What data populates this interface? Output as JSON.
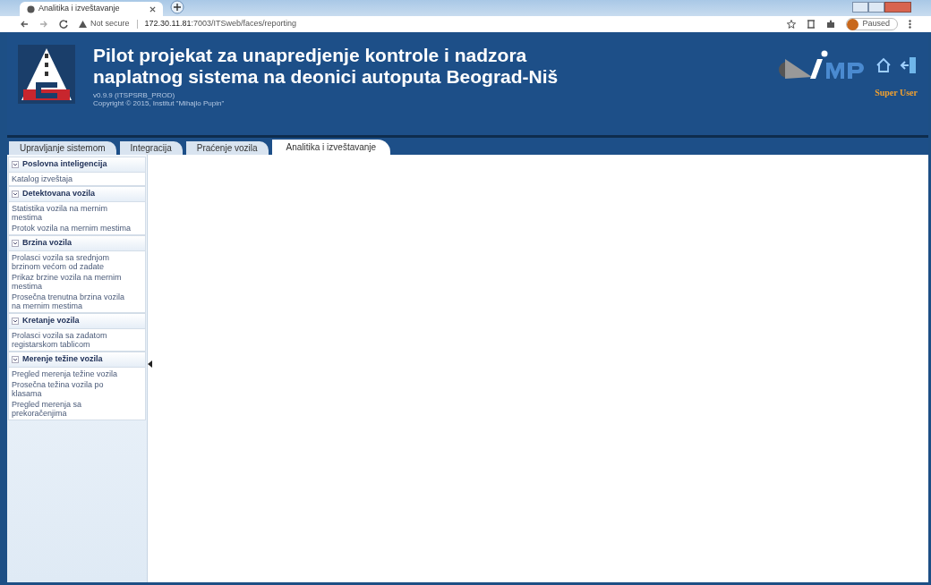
{
  "browser": {
    "tab_title": "Analitika i izveštavanje",
    "url_host": "172.30.11.81",
    "url_path": ":7003/ITSweb/faces/reporting",
    "security": "Not secure",
    "profile": "Paused"
  },
  "header": {
    "title_lines": [
      "Pilot projekat za unapredjenje kontrole i nadzora",
      "naplatnog sistema na deonici autoputa Beograd-Niš"
    ],
    "version": "v0.9.9 (ITSPSRB_PROD)",
    "copyright": "Copyright © 2015, Institut \"Mihajlo Pupin\"",
    "user": "Super User"
  },
  "tabs": [
    {
      "label": "Upravljanje sistemom",
      "selected": false
    },
    {
      "label": "Integracija",
      "selected": false
    },
    {
      "label": "Praćenje vozila",
      "selected": false
    },
    {
      "label": "Analitika i izveštavanje",
      "selected": true
    }
  ],
  "sidebar": {
    "sections": [
      {
        "title": "Poslovna inteligencija",
        "expanded": true,
        "items": [
          "Katalog izveštaja"
        ]
      },
      {
        "title": "Detektovana vozila",
        "expanded": true,
        "items": [
          "Statistika vozila na mernim mestima",
          "Protok vozila na mernim mestima"
        ]
      },
      {
        "title": "Brzina vozila",
        "expanded": true,
        "items": [
          "Prolasci vozila sa srednjom brzinom većom od zadate",
          "Prikaz brzine vozila na mernim mestima",
          "Prosečna trenutna brzina vozila na mernim mestima"
        ]
      },
      {
        "title": "Kretanje vozila",
        "expanded": true,
        "items": [
          "Prolasci vozila sa zadatom registarskom tablicom"
        ]
      },
      {
        "title": "Merenje težine vozila",
        "expanded": true,
        "items": [
          "Pregled merenja težine vozila",
          "Prosečna težina vozila po klasama",
          "Pregled merenja sa prekoračenjima"
        ]
      }
    ]
  }
}
